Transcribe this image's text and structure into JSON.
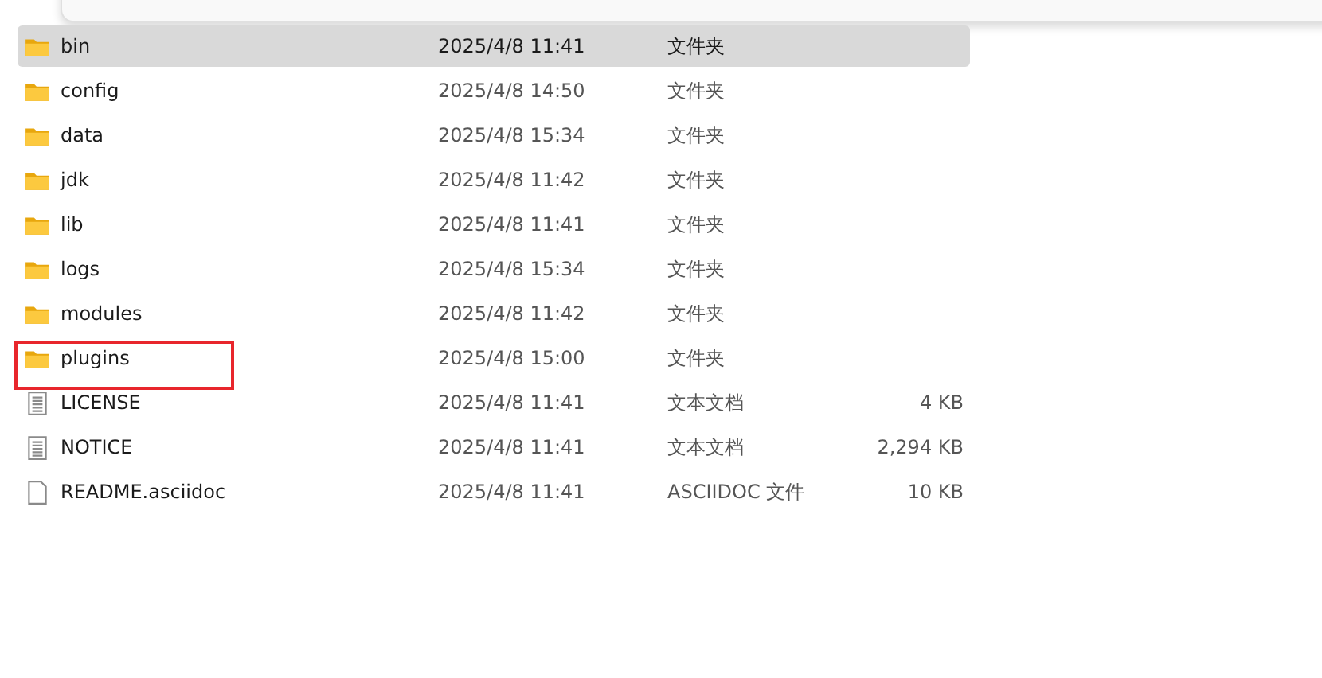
{
  "files": [
    {
      "name": "bin",
      "modified": "2025/4/8 11:41",
      "type": "文件夹",
      "kind": "folder",
      "selected": true,
      "marked": false
    },
    {
      "name": "config",
      "modified": "2025/4/8 14:50",
      "type": "文件夹",
      "kind": "folder",
      "selected": false,
      "marked": false
    },
    {
      "name": "data",
      "modified": "2025/4/8 15:34",
      "type": "文件夹",
      "kind": "folder",
      "selected": false,
      "marked": false
    },
    {
      "name": "jdk",
      "modified": "2025/4/8 11:42",
      "type": "文件夹",
      "kind": "folder",
      "selected": false,
      "marked": false
    },
    {
      "name": "lib",
      "modified": "2025/4/8 11:41",
      "type": "文件夹",
      "kind": "folder",
      "selected": false,
      "marked": false
    },
    {
      "name": "logs",
      "modified": "2025/4/8 15:34",
      "type": "文件夹",
      "kind": "folder",
      "selected": false,
      "marked": false
    },
    {
      "name": "modules",
      "modified": "2025/4/8 11:42",
      "type": "文件夹",
      "kind": "folder",
      "selected": false,
      "marked": false
    },
    {
      "name": "plugins",
      "modified": "2025/4/8 15:00",
      "type": "文件夹",
      "kind": "folder",
      "selected": false,
      "marked": true
    },
    {
      "name": "LICENSE",
      "modified": "2025/4/8 11:41",
      "type": "文本文档",
      "size": "4 KB",
      "kind": "text",
      "selected": false,
      "marked": false
    },
    {
      "name": "NOTICE",
      "modified": "2025/4/8 11:41",
      "type": "文本文档",
      "size": "2,294 KB",
      "kind": "text",
      "selected": false,
      "marked": false
    },
    {
      "name": "README.asciidoc",
      "modified": "2025/4/8 11:41",
      "type": "ASCIIDOC 文件",
      "size": "10 KB",
      "kind": "file",
      "selected": false,
      "marked": false
    }
  ]
}
